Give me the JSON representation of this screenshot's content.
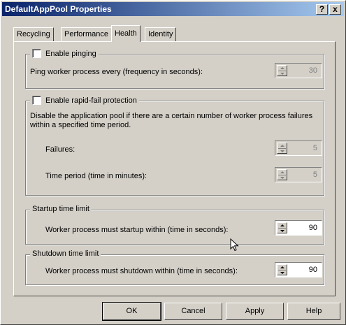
{
  "window": {
    "title": "DefaultAppPool Properties",
    "help_btn": "?",
    "close_btn": "x"
  },
  "tabs": [
    {
      "label": "Recycling"
    },
    {
      "label": "Performance"
    },
    {
      "label": "Health"
    },
    {
      "label": "Identity"
    }
  ],
  "pinging": {
    "checkbox_label": "Enable pinging",
    "row_label": "Ping worker process every (frequency in seconds):",
    "value": "30"
  },
  "rapid_fail": {
    "checkbox_label": "Enable rapid-fail protection",
    "description": "Disable the application pool if there are a certain number of worker process failures within a specified time period.",
    "failures_label": "Failures:",
    "failures_value": "5",
    "time_label": "Time period (time in minutes):",
    "time_value": "5"
  },
  "startup": {
    "group_label": "Startup time limit",
    "row_label": "Worker process must startup within (time in seconds):",
    "value": "90"
  },
  "shutdown": {
    "group_label": "Shutdown time limit",
    "row_label": "Worker process must shutdown within (time in seconds):",
    "value": "90"
  },
  "buttons": {
    "ok": "OK",
    "cancel": "Cancel",
    "apply": "Apply",
    "help": "Help"
  }
}
